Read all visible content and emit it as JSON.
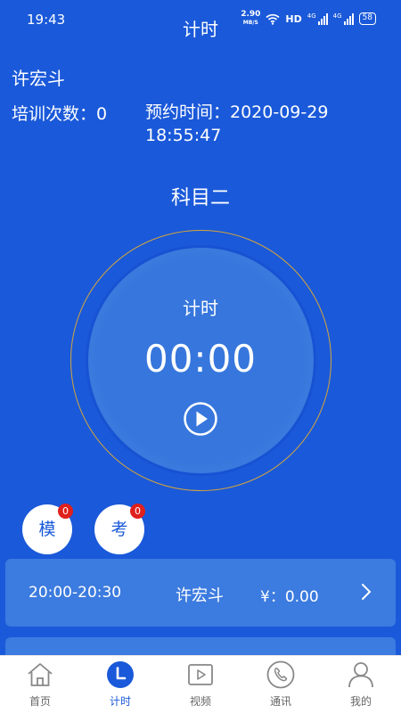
{
  "status": {
    "time": "19:43",
    "speed_value": "2.90",
    "speed_unit": "MB/S",
    "hd": "HD",
    "net1": "4G",
    "net2": "4G",
    "battery": "58"
  },
  "header": {
    "title": "计时"
  },
  "info": {
    "name": "许宏斗",
    "train_count": "培训次数：0",
    "appoint_label": "预约时间：2020-09-29 18:55:47"
  },
  "subject": "科目二",
  "timer": {
    "label": "计时",
    "value": "00:00"
  },
  "buttons": {
    "mo_label": "模",
    "mo_badge": "0",
    "kao_label": "考",
    "kao_badge": "0"
  },
  "appointments": [
    {
      "time": "20:00-20:30",
      "name": "许宏斗",
      "fee": "¥：0.00"
    }
  ],
  "nav": [
    {
      "label": "首页",
      "icon": "home-icon"
    },
    {
      "label": "计时",
      "icon": "clock-icon"
    },
    {
      "label": "视频",
      "icon": "video-icon"
    },
    {
      "label": "通讯",
      "icon": "phone-icon"
    },
    {
      "label": "我的",
      "icon": "user-icon"
    }
  ],
  "colors": {
    "background": "#1a59d9",
    "ring": "#d4a53c",
    "circle": "#3777dd",
    "badge": "#e0201c",
    "nav_active": "#1a59d9"
  }
}
